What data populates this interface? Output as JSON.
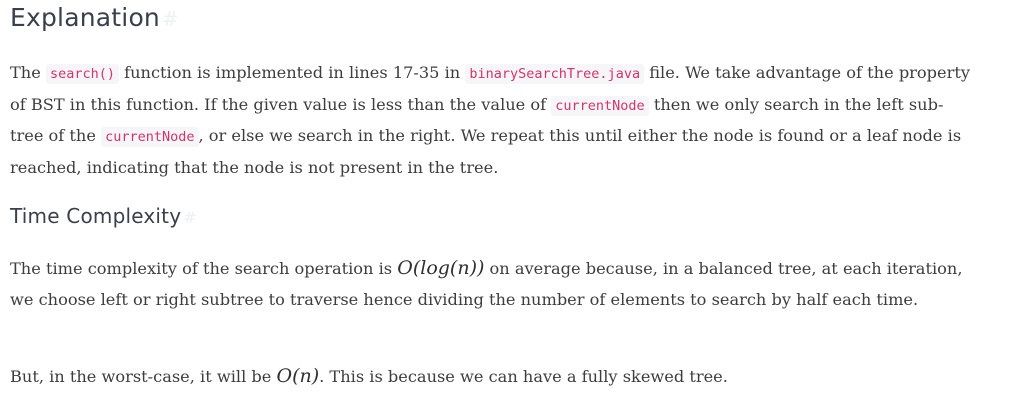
{
  "heading_main": "Explanation",
  "heading_main_anchor": "#",
  "paragraph1": {
    "t1": "The ",
    "code1": "search()",
    "t2": " function is implemented in lines 17-35 in ",
    "code2": "binarySearchTree.java",
    "t3": " file. We take advantage of the property of BST in this function. If the given value is less than the value of ",
    "code3": "currentNode",
    "t4": " then we only search in the left sub-tree of the ",
    "code4": "currentNode",
    "t5": ", or else we search in the right. We repeat this until either the node is found or a leaf node is reached, indicating that the node is not present in the tree."
  },
  "heading_sub": "Time Complexity",
  "heading_sub_anchor": "#",
  "paragraph2": {
    "t1": "The time complexity of the search operation is ",
    "math1": "O(log(n))",
    "t2": " on average because, in a balanced tree, at each iteration, we choose left or right subtree to traverse hence dividing the number of elements to search by half each time."
  },
  "paragraph3": {
    "t1": "But, in the worst-case, it will be ",
    "math1": "O(n)",
    "t2": ". This is because we can have a fully skewed tree."
  }
}
